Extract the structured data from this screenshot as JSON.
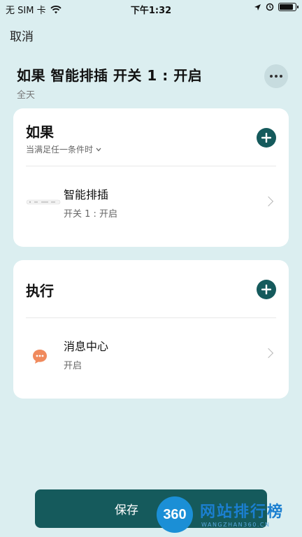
{
  "status_bar": {
    "carrier": "无 SIM 卡",
    "time": "下午1:32",
    "battery_level": 0.9
  },
  "nav": {
    "cancel_label": "取消"
  },
  "rule": {
    "title": "如果 智能排插 开关 1 : 开启",
    "subtitle": "全天"
  },
  "if_card": {
    "heading": "如果",
    "condition": "当满足任一条件时",
    "items": [
      {
        "title": "智能排插",
        "subtitle": "开关 1 : 开启",
        "icon": "smart-plug-image"
      }
    ]
  },
  "do_card": {
    "heading": "执行",
    "items": [
      {
        "title": "消息中心",
        "subtitle": "开启",
        "icon": "message-icon"
      }
    ]
  },
  "save_label": "保存",
  "watermark": {
    "badge": "360",
    "text": "网站排行榜",
    "url": "WANGZHAN360.CN"
  },
  "colors": {
    "background": "#dbeef0",
    "accent": "#155a5c",
    "message_icon": "#f08a5d"
  }
}
